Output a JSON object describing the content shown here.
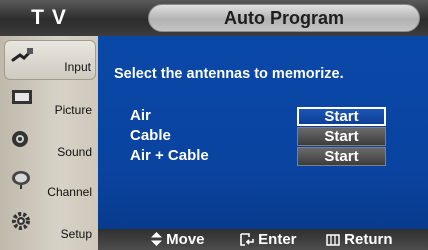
{
  "header": {
    "source_label": "T V",
    "title": "Auto Program"
  },
  "sidebar": {
    "items": [
      {
        "label": "Input",
        "icon": "plug-icon",
        "active": true
      },
      {
        "label": "Picture",
        "icon": "picture-icon"
      },
      {
        "label": "Sound",
        "icon": "speaker-icon"
      },
      {
        "label": "Channel",
        "icon": "satellite-dish-icon"
      },
      {
        "label": "Setup",
        "icon": "gear-icon"
      }
    ]
  },
  "main": {
    "instruction": "Select the antennas to memorize.",
    "options": [
      {
        "label": "Air",
        "button": "Start",
        "focused": true
      },
      {
        "label": "Cable",
        "button": "Start"
      },
      {
        "label": "Air + Cable",
        "button": "Start"
      }
    ]
  },
  "footer": {
    "hints": [
      {
        "icon": "up-down-arrow-icon",
        "label": "Move"
      },
      {
        "icon": "enter-icon",
        "label": "Enter"
      },
      {
        "icon": "return-menu-icon",
        "label": "Return"
      }
    ]
  },
  "colors": {
    "panel": "#0a45a3",
    "focus_border": "#ffffff",
    "sidebar": "#cfc9bc",
    "header": "#333333"
  }
}
